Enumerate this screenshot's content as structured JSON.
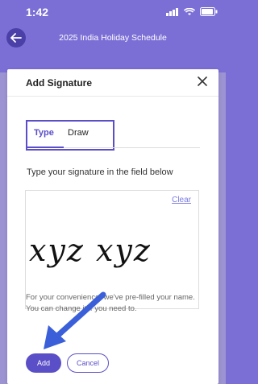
{
  "status_bar": {
    "time": "1:42"
  },
  "header": {
    "title": "2025 India Holiday Schedule"
  },
  "modal": {
    "title": "Add Signature",
    "tabs": [
      {
        "label": "Type"
      },
      {
        "label": "Draw"
      }
    ],
    "instruction": "Type your signature in the field below",
    "clear_label": "Clear",
    "signature_text": "xyz xyz",
    "note": "For your convenience, we've pre-filled your name. You can change it if you need to.",
    "add_label": "Add",
    "cancel_label": "Cancel"
  },
  "colors": {
    "accent": "#5b4fc7",
    "header_bg": "#7b6fd6",
    "arrow": "#3a5fd9"
  }
}
